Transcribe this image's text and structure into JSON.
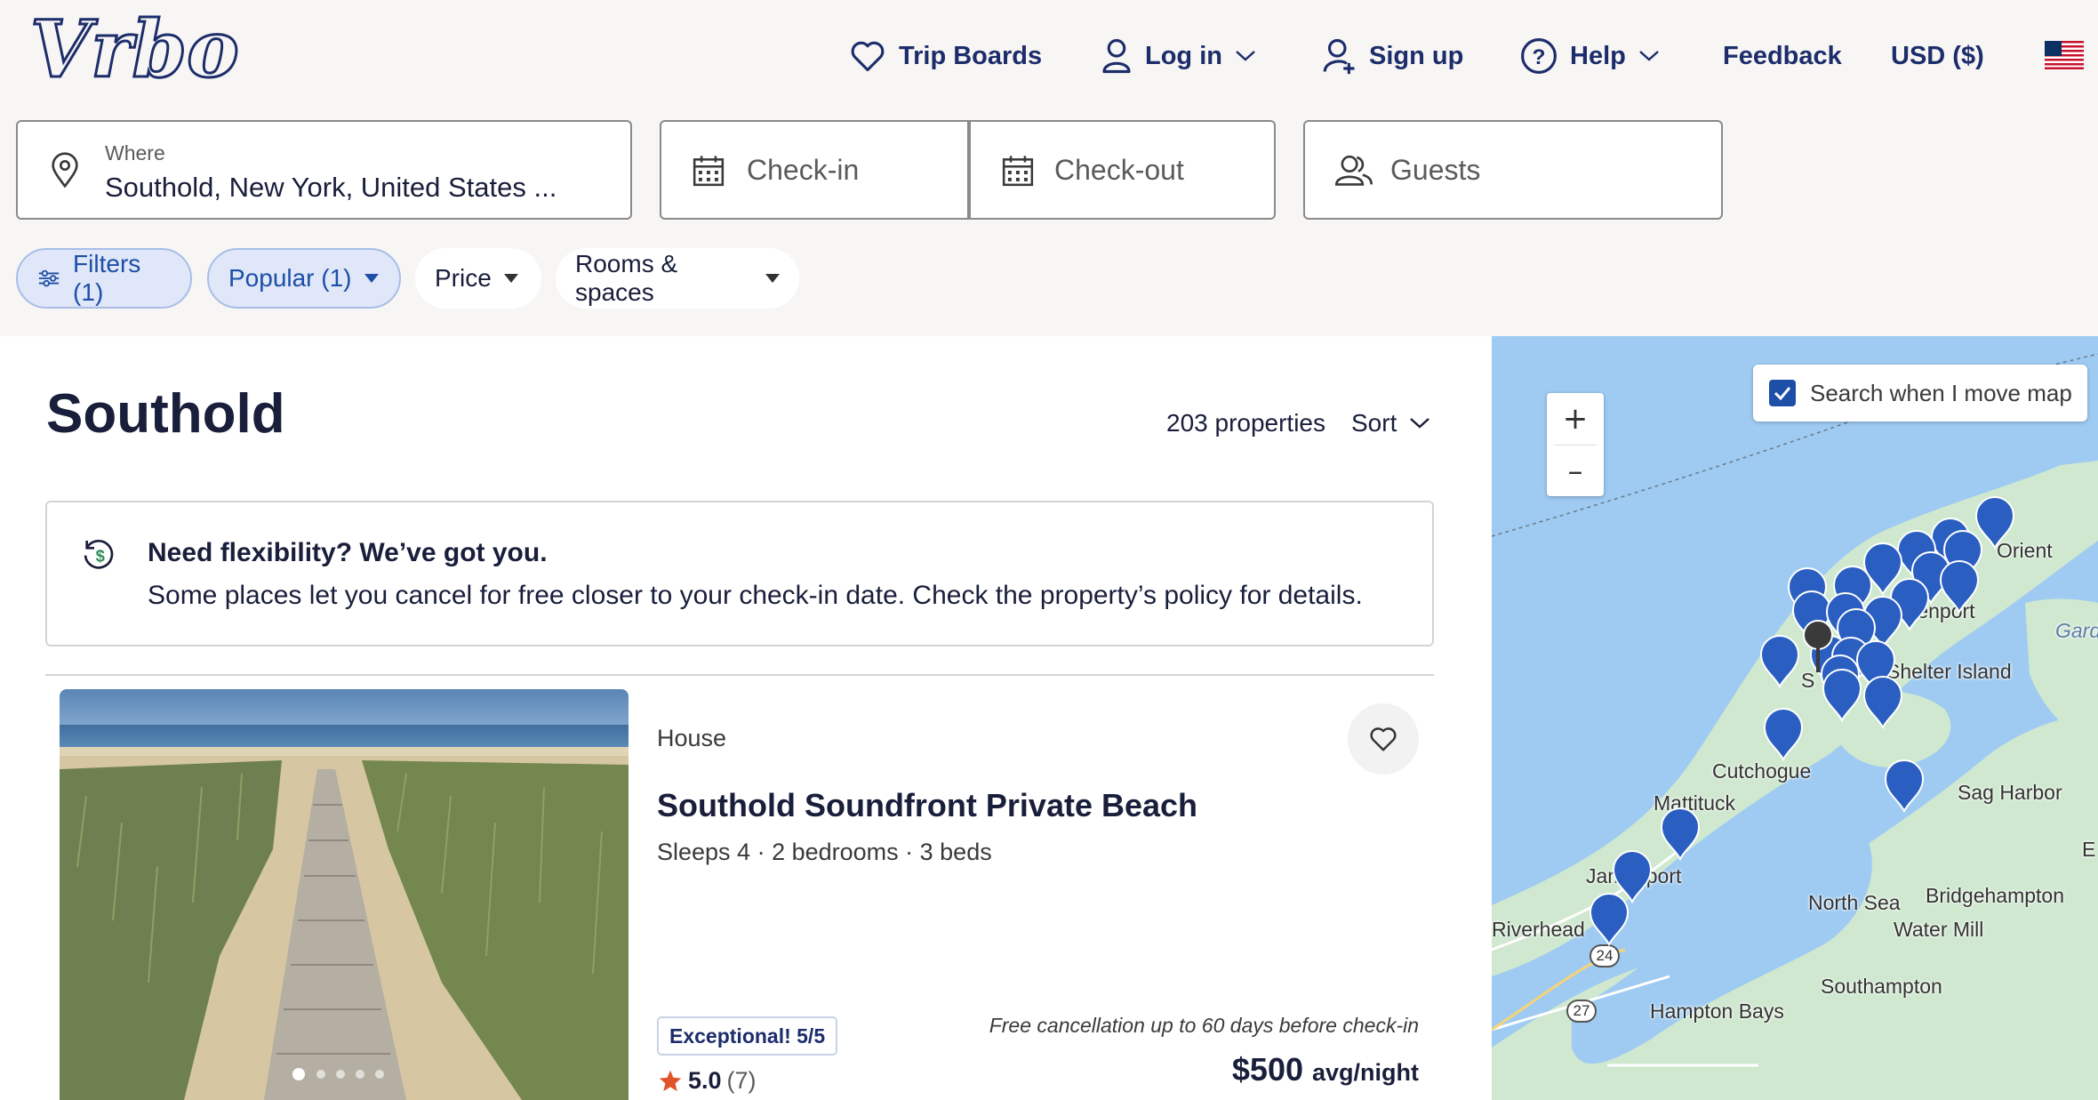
{
  "header": {
    "logo_text": "Vrbo",
    "nav": {
      "trip_boards": "Trip Boards",
      "log_in": "Log in",
      "sign_up": "Sign up",
      "help": "Help",
      "feedback": "Feedback",
      "currency": "USD ($)"
    },
    "brand_color": "#1d2d6b"
  },
  "search": {
    "where_label": "Where",
    "where_value": "Southold, New York, United States ...",
    "checkin_placeholder": "Check-in",
    "checkout_placeholder": "Check-out",
    "guests_placeholder": "Guests"
  },
  "filters": {
    "filters": "Filters (1)",
    "popular": "Popular (1)",
    "price": "Price",
    "rooms": "Rooms & spaces"
  },
  "results": {
    "title": "Southold",
    "count": "203 properties",
    "sort_label": "Sort"
  },
  "flex_banner": {
    "title": "Need flexibility? We’ve got you.",
    "text": "Some places let you cancel for free closer to your check-in date. Check the property’s policy for details."
  },
  "listing": {
    "type": "House",
    "name": "Southold Soundfront Private Beach",
    "details": "Sleeps 4 · 2 bedrooms · 3 beds",
    "badge": "Exceptional! 5/5",
    "rating": "5.0",
    "reviews": "(7)",
    "cancellation": "Free cancellation up to 60 days before check-in",
    "price": "$500",
    "price_unit": "avg/night",
    "photo_dots": 5,
    "photo_active_dot": 1
  },
  "map": {
    "search_when_move": "Search when I move map",
    "search_when_move_checked": true,
    "zoom_in": "+",
    "zoom_out": "–",
    "labels": {
      "orient": "Orient",
      "greenport": "Greenport",
      "shelter_island": "Shelter Island",
      "cutchogue": "Cutchogue",
      "mattituck": "Mattituck",
      "jamesport": "Jamesport",
      "riverhead": "Riverhead",
      "sag_harbor": "Sag Harbor",
      "north_sea": "North Sea",
      "bridgehampton": "Bridgehampton",
      "water_mill": "Water Mill",
      "southampton": "Southampton",
      "hampton_bays": "Hampton Bays",
      "gard": "Gard",
      "e": "E",
      "southold": "S"
    },
    "route_24": "24",
    "route_27": "27",
    "pin_color": "#2b5ec1",
    "water_color": "#9fcbf2",
    "land_color": "#cfe8cf"
  }
}
